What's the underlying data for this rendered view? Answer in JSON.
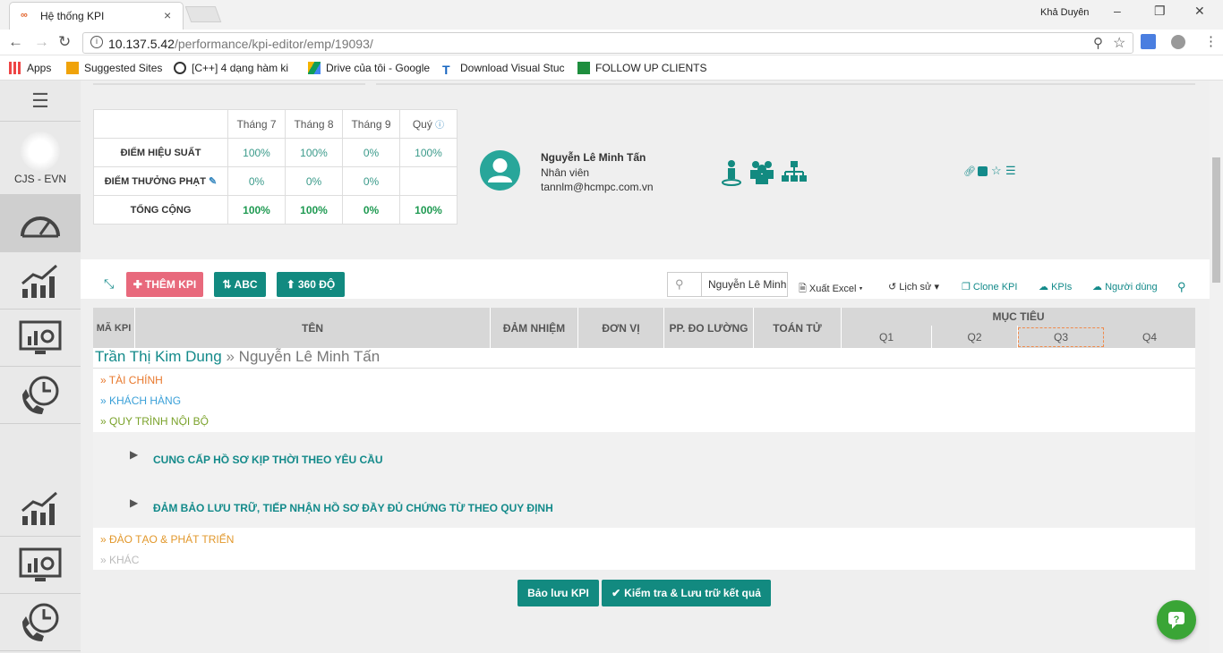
{
  "browser": {
    "tab_title": "Hệ thống KPI",
    "user": "Khả Duyên",
    "url_host": "10.137.5.42",
    "url_path": "/performance/kpi-editor/emp/19093/",
    "bookmarks": [
      "Apps",
      "Suggested Sites",
      "[C++] 4 dạng hàm ki",
      "Drive của tôi - Google",
      "Download Visual Stuc",
      "FOLLOW UP CLIENTS"
    ]
  },
  "sidebar": {
    "org_label": "CJS - EVN"
  },
  "score_table": {
    "headers": [
      "Tháng 7",
      "Tháng 8",
      "Tháng 9",
      "Quý"
    ],
    "rows": [
      {
        "label": "ĐIỂM HIỆU SUẤT",
        "values": [
          "100%",
          "100%",
          "0%",
          "100%"
        ]
      },
      {
        "label": "ĐIỂM THƯỞNG PHẠT",
        "values": [
          "0%",
          "0%",
          "0%",
          ""
        ]
      },
      {
        "label": "TỔNG CỘNG",
        "values": [
          "100%",
          "100%",
          "0%",
          "100%"
        ]
      }
    ]
  },
  "profile": {
    "name": "Nguyễn Lê Minh Tấn",
    "role": "Nhân viên",
    "email": "tannlm@hcmpc.com.vn"
  },
  "toolbar": {
    "add_kpi": "THÊM KPI",
    "abc": "ABC",
    "deg360": "360 ĐỘ",
    "search_value": "Nguyễn Lê Minh",
    "export": "Xuất Excel",
    "history": "Lịch sử",
    "clone": "Clone KPI",
    "kpis": "KPIs",
    "users": "Người dùng"
  },
  "grid": {
    "headers": {
      "code": "MÃ KPI",
      "name": "TÊN",
      "duty": "ĐẢM NHIỆM",
      "unit": "ĐƠN VỊ",
      "method": "PP. ĐO LƯỜNG",
      "operator": "TOÁN TỬ",
      "target": "MỤC TIÊU"
    },
    "quarters": [
      "Q1",
      "Q2",
      "Q3",
      "Q4"
    ],
    "breadcrumb_manager": "Trần Thị Kim Dung",
    "breadcrumb_employee": "Nguyễn Lê Minh Tấn",
    "categories": [
      {
        "label": "TÀI CHÍNH",
        "color": "#e8782c"
      },
      {
        "label": "KHÁCH HÀNG",
        "color": "#3aa0d8"
      },
      {
        "label": "QUY TRÌNH NỘI BỘ",
        "color": "#7aa22a"
      },
      {
        "label": "ĐÀO TẠO & PHÁT TRIỂN",
        "color": "#e2982c"
      },
      {
        "label": "KHÁC",
        "color": "#bbbbbb"
      }
    ],
    "items": [
      "CUNG CẤP HỒ SƠ KỊP THỜI THEO YÊU CẦU",
      "ĐẢM BẢO LƯU TRỮ, TIẾP NHẬN HỒ SƠ ĐẦY ĐỦ CHỨNG TỪ THEO QUY ĐỊNH"
    ]
  },
  "actions": {
    "save": "Bảo lưu KPI",
    "check_save": "Kiểm tra & Lưu trữ kết quả"
  },
  "colors": {
    "teal": "#128a80",
    "pink": "#e8697c",
    "accent": "#28a69a"
  }
}
